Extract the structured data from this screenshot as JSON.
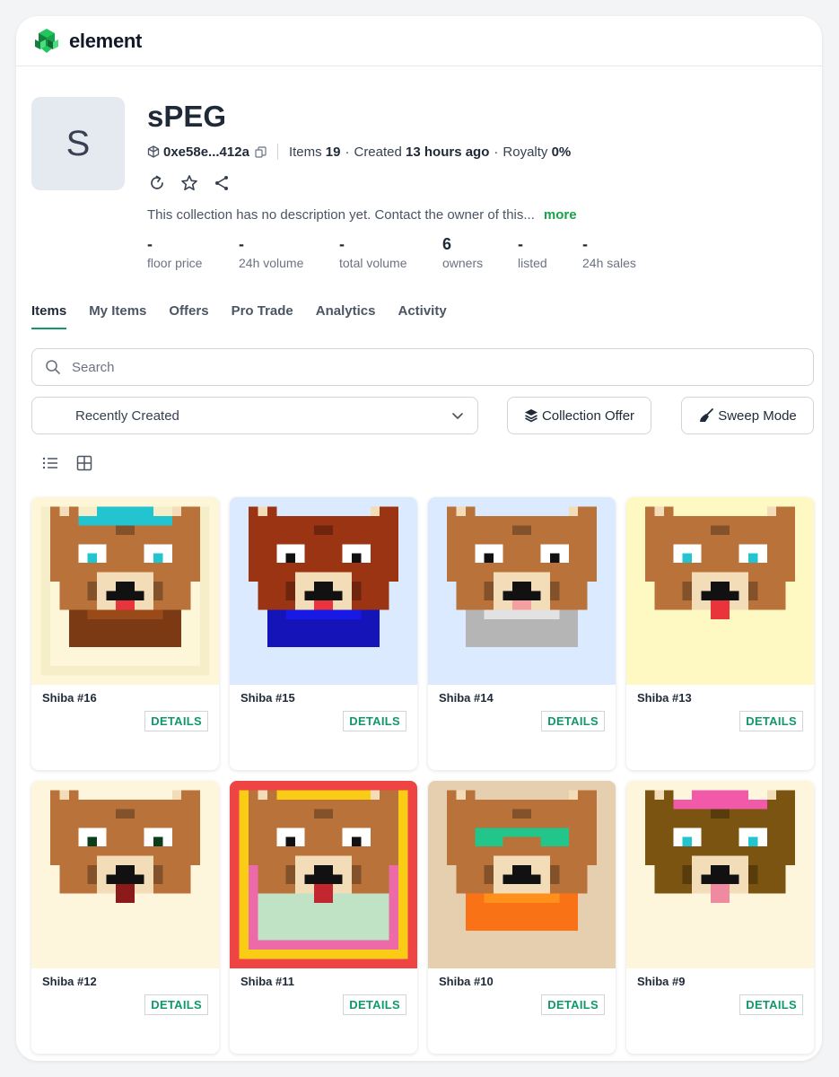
{
  "brand": {
    "name": "element"
  },
  "collection": {
    "avatar_letter": "S",
    "name": "sPEG",
    "address": "0xe58e...412a",
    "items_label": "Items",
    "items_count": "19",
    "created_label": "Created",
    "created_value": "13 hours ago",
    "royalty_label": "Royalty",
    "royalty_value": "0%",
    "description": "This collection has no description yet. Contact the owner of this...",
    "more_label": "more"
  },
  "stats": [
    {
      "value": "-",
      "label": "floor price"
    },
    {
      "value": "-",
      "label": "24h volume"
    },
    {
      "value": "-",
      "label": "total volume"
    },
    {
      "value": "6",
      "label": "owners"
    },
    {
      "value": "-",
      "label": "listed"
    },
    {
      "value": "-",
      "label": "24h sales"
    }
  ],
  "tabs": [
    {
      "label": "Items",
      "active": true
    },
    {
      "label": "My Items"
    },
    {
      "label": "Offers"
    },
    {
      "label": "Pro Trade"
    },
    {
      "label": "Analytics"
    },
    {
      "label": "Activity"
    }
  ],
  "search": {
    "placeholder": "Search"
  },
  "sort": {
    "selected": "Recently Created"
  },
  "buttons": {
    "collection_offer": "Collection Offer",
    "sweep_mode": "Sweep Mode"
  },
  "details_label": "DETAILS",
  "icons": [
    "collection-chain-icon",
    "copy-icon",
    "refresh-icon",
    "star-icon",
    "share-icon",
    "search-icon",
    "chevron-down-icon",
    "layers-icon",
    "broom-icon",
    "list-view-icon",
    "grid-view-icon"
  ],
  "items": [
    {
      "name": "Shiba #16",
      "bg": "#fdf6d8",
      "fur": "#b8723a",
      "hat": "#22c4cf",
      "eye": "#22c4cf",
      "shirt": "#7b3a13",
      "frame": "#f6edc9",
      "tongue": "#e8343a"
    },
    {
      "name": "Shiba #15",
      "bg": "#dbeafe",
      "fur": "#9a3412",
      "hat": "",
      "eye": "#111111",
      "shirt": "#1414b8",
      "frame": "",
      "tongue": "#e8343a"
    },
    {
      "name": "Shiba #14",
      "bg": "#dbeafe",
      "fur": "#b8723a",
      "hat": "",
      "eye": "#111111",
      "shirt": "#b5b5b5",
      "frame": "",
      "tongue": "#f4a0a0"
    },
    {
      "name": "Shiba #13",
      "bg": "#fef9c3",
      "fur": "#b8723a",
      "hat": "",
      "eye": "#22c4cf",
      "shirt": "",
      "frame": "",
      "tongue": "#e8343a"
    },
    {
      "name": "Shiba #12",
      "bg": "#fef6dc",
      "fur": "#b8723a",
      "hat": "",
      "eye": "#0b3d1a",
      "shirt": "",
      "frame": "",
      "tongue": "#8b1a1a"
    },
    {
      "name": "Shiba #11",
      "bg": "#bfe3c4",
      "fur": "#b8723a",
      "hat": "",
      "eye": "#111111",
      "shirt": "",
      "frame": "rainbow",
      "tongue": "#c2262e"
    },
    {
      "name": "Shiba #10",
      "bg": "#e6cfae",
      "fur": "#b8723a",
      "hat": "",
      "eye": "#111111",
      "shirt": "#f97316",
      "glasses": "#22c58a",
      "frame": "",
      "tongue": ""
    },
    {
      "name": "Shiba #9",
      "bg": "#fef6dc",
      "fur": "#7a5410",
      "hat": "#f05aa8",
      "eye": "#22c4cf",
      "shirt": "",
      "frame": "",
      "tongue": "#f08aa0"
    }
  ]
}
